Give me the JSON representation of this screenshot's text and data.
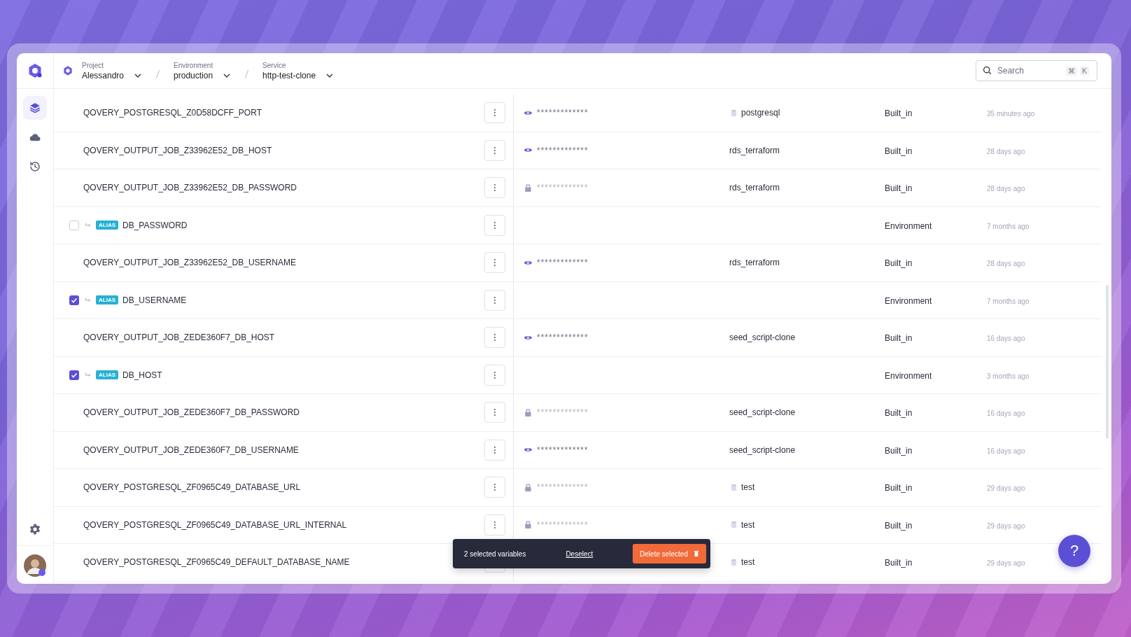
{
  "breadcrumb": [
    {
      "label": "Project",
      "value": "Alessandro"
    },
    {
      "label": "Environment",
      "value": "production"
    },
    {
      "label": "Service",
      "value": "http-test-clone"
    }
  ],
  "search": {
    "placeholder": "Search",
    "keys": [
      "⌘",
      "K"
    ]
  },
  "sidebar": {
    "items": [
      {
        "selected": true
      },
      {
        "selected": false
      },
      {
        "selected": false
      }
    ]
  },
  "rows": [
    {
      "kind": "variable",
      "name": "QOVERY_POSTGRESQL_Z0D58DCFF_PORT",
      "secret": false,
      "value": "*************",
      "service": "postgresql",
      "service_icon": true,
      "type": "Built_in",
      "updated": "35 minutes ago"
    },
    {
      "kind": "variable",
      "name": "QOVERY_OUTPUT_JOB_Z33962E52_DB_HOST",
      "secret": false,
      "value": "*************",
      "service": "rds_terraform",
      "service_icon": false,
      "type": "Built_in",
      "updated": "28 days ago"
    },
    {
      "kind": "variable",
      "name": "QOVERY_OUTPUT_JOB_Z33962E52_DB_PASSWORD",
      "secret": true,
      "value": "*************",
      "service": "rds_terraform",
      "service_icon": false,
      "type": "Built_in",
      "updated": "28 days ago"
    },
    {
      "kind": "alias",
      "badge": "ALIAS",
      "name": "DB_PASSWORD",
      "selected": false,
      "type": "Environment",
      "updated": "7 months ago"
    },
    {
      "kind": "variable",
      "name": "QOVERY_OUTPUT_JOB_Z33962E52_DB_USERNAME",
      "secret": false,
      "value": "*************",
      "service": "rds_terraform",
      "service_icon": false,
      "type": "Built_in",
      "updated": "28 days ago"
    },
    {
      "kind": "alias",
      "badge": "ALIAS",
      "name": "DB_USERNAME",
      "selected": true,
      "type": "Environment",
      "updated": "7 months ago"
    },
    {
      "kind": "variable",
      "name": "QOVERY_OUTPUT_JOB_ZEDE360F7_DB_HOST",
      "secret": false,
      "value": "*************",
      "service": "seed_script-clone",
      "service_icon": false,
      "type": "Built_in",
      "updated": "16 days ago"
    },
    {
      "kind": "alias",
      "badge": "ALIAS",
      "name": "DB_HOST",
      "selected": true,
      "type": "Environment",
      "updated": "3 months ago"
    },
    {
      "kind": "variable",
      "name": "QOVERY_OUTPUT_JOB_ZEDE360F7_DB_PASSWORD",
      "secret": true,
      "value": "*************",
      "service": "seed_script-clone",
      "service_icon": false,
      "type": "Built_in",
      "updated": "16 days ago"
    },
    {
      "kind": "variable",
      "name": "QOVERY_OUTPUT_JOB_ZEDE360F7_DB_USERNAME",
      "secret": false,
      "value": "*************",
      "service": "seed_script-clone",
      "service_icon": false,
      "type": "Built_in",
      "updated": "16 days ago"
    },
    {
      "kind": "variable",
      "name": "QOVERY_POSTGRESQL_ZF0965C49_DATABASE_URL",
      "secret": true,
      "value": "*************",
      "service": "test",
      "service_icon": true,
      "type": "Built_in",
      "updated": "29 days ago"
    },
    {
      "kind": "variable",
      "name": "QOVERY_POSTGRESQL_ZF0965C49_DATABASE_URL_INTERNAL",
      "secret": true,
      "value": "*************",
      "service": "test",
      "service_icon": true,
      "type": "Built_in",
      "updated": "29 days ago"
    },
    {
      "kind": "variable",
      "name": "QOVERY_POSTGRESQL_ZF0965C49_DEFAULT_DATABASE_NAME",
      "service": "test",
      "service_icon": true,
      "type": "Built_in",
      "updated": "29 days ago"
    }
  ],
  "selection_bar": {
    "count": "2 selected variables",
    "deselect": "Deselect",
    "delete": "Delete selected"
  },
  "help": {
    "label": "?"
  }
}
